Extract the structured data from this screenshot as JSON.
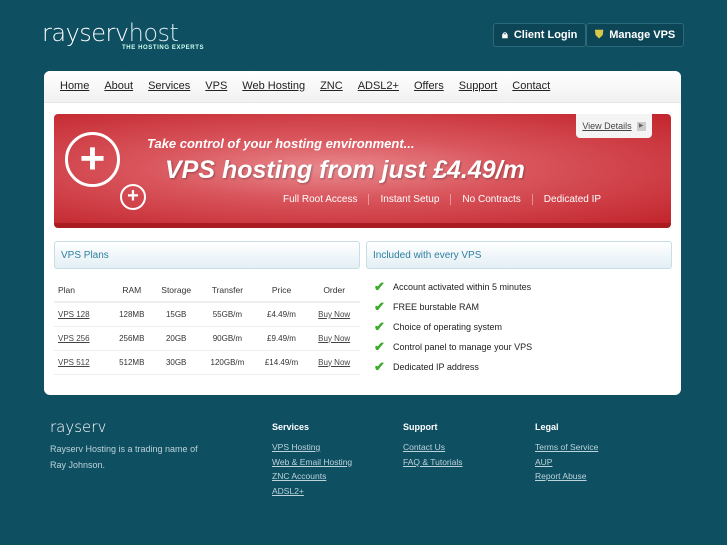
{
  "header": {
    "logo_main": "rayserv",
    "logo_accent": "host",
    "tagline": "THE HOSTING EXPERTS",
    "client_login": "Client Login",
    "manage_vps": "Manage VPS"
  },
  "nav": [
    "Home",
    "About",
    "Services",
    "VPS",
    "Web Hosting",
    "ZNC",
    "ADSL2+",
    "Offers",
    "Support",
    "Contact"
  ],
  "banner": {
    "line1": "Take control of your hosting environment...",
    "line2": "VPS hosting from just £4.49/m",
    "features": [
      "Full Root Access",
      "Instant Setup",
      "No Contracts",
      "Dedicated IP"
    ],
    "view_details": "View Details"
  },
  "plans": {
    "title": "VPS Plans",
    "columns": [
      "Plan",
      "RAM",
      "Storage",
      "Transfer",
      "Price",
      "Order"
    ],
    "rows": [
      [
        "VPS 128",
        "128MB",
        "15GB",
        "55GB/m",
        "£4.49/m",
        "Buy Now"
      ],
      [
        "VPS 256",
        "256MB",
        "20GB",
        "90GB/m",
        "£9.49/m",
        "Buy Now"
      ],
      [
        "VPS 512",
        "512MB",
        "30GB",
        "120GB/m",
        "£14.49/m",
        "Buy Now"
      ]
    ]
  },
  "included": {
    "title": "Included with every VPS",
    "items": [
      "Account activated within 5 minutes",
      "FREE burstable RAM",
      "Choice of operating system",
      "Control panel to manage your VPS",
      "Dedicated IP address"
    ]
  },
  "footer": {
    "logo": "rayserv",
    "desc": "Rayserv Hosting is a trading name of Ray Johnson.",
    "services": {
      "title": "Services",
      "links": [
        "VPS Hosting",
        "Web & Email Hosting",
        "ZNC Accounts",
        "ADSL2+"
      ]
    },
    "support": {
      "title": "Support",
      "links": [
        "Contact Us",
        "FAQ & Tutorials"
      ]
    },
    "legal": {
      "title": "Legal",
      "links": [
        "Terms of Service",
        "AUP",
        "Report Abuse"
      ]
    }
  },
  "colors": {
    "background": "#0f4f62",
    "banner": "#c2242c",
    "accent": "#2d7fa0",
    "check": "#3caa2c"
  }
}
